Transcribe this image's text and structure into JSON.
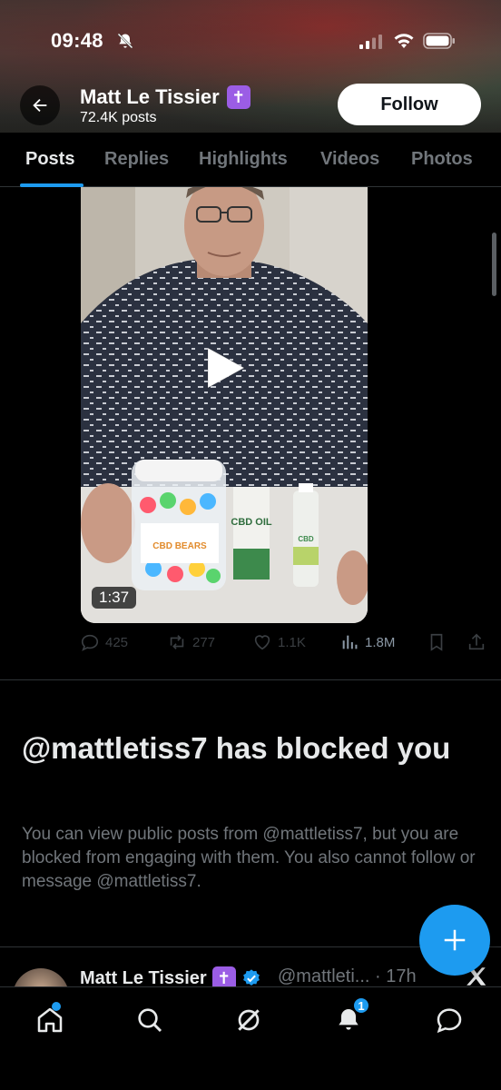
{
  "status_bar": {
    "time": "09:48"
  },
  "header": {
    "profile_name": "Matt Le Tissier",
    "name_badge": "✝",
    "post_count": "72.4K posts",
    "follow_label": "Follow"
  },
  "tabs": [
    {
      "label": "Posts",
      "active": true
    },
    {
      "label": "Replies",
      "active": false
    },
    {
      "label": "Highlights",
      "active": false
    },
    {
      "label": "Videos",
      "active": false
    },
    {
      "label": "Photos",
      "active": false
    }
  ],
  "post": {
    "video_duration": "1:37",
    "products": {
      "jar_label": "CBD BEARS",
      "box_label": "CBD OIL",
      "pump_label": "CBD"
    },
    "stats": {
      "replies": "425",
      "reposts": "277",
      "likes": "1.1K",
      "views": "1.8M"
    }
  },
  "blocked": {
    "title": "@mattletiss7 has blocked you",
    "body": "You can view public posts from @mattletiss7, but you are blocked from engaging with them. You also cannot follow or message @mattletiss7."
  },
  "next_post": {
    "name": "Matt Le Tissier",
    "handle_time": "@mattleti... · 17h"
  },
  "bottom_nav": {
    "notifications_count": "1"
  },
  "colors": {
    "accent": "#1d9bf0",
    "badge_purple": "#9b5de5",
    "background": "#000000",
    "muted_text": "#71767b"
  }
}
